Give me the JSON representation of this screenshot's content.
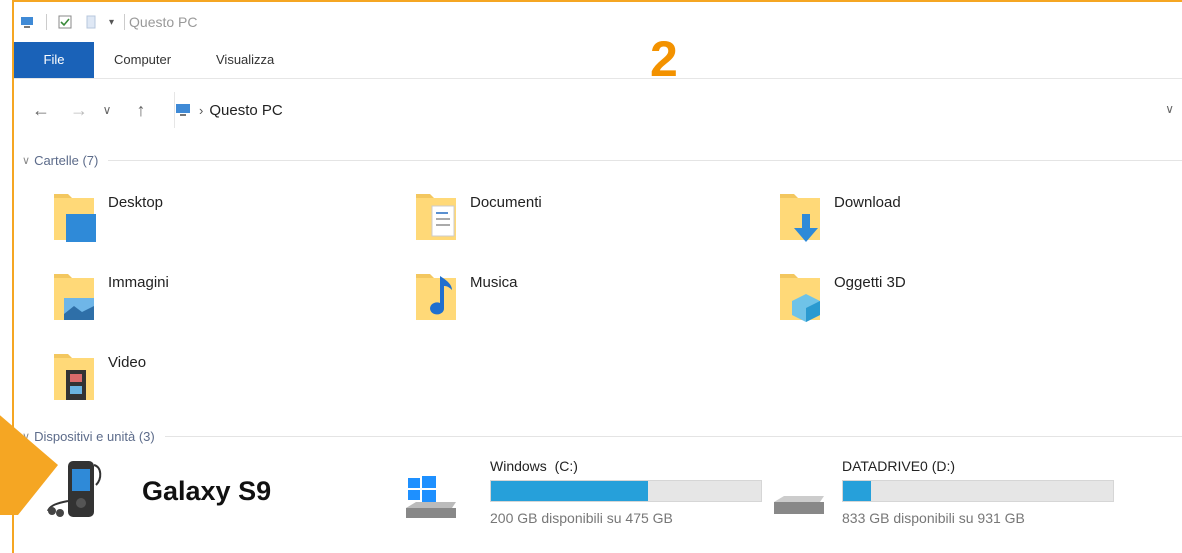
{
  "window": {
    "title": "Questo PC"
  },
  "ribbon": {
    "tabs": [
      {
        "label": "File"
      },
      {
        "label": "Computer"
      },
      {
        "label": "Visualizza"
      }
    ]
  },
  "step_number": "2",
  "address": {
    "path": "Questo PC"
  },
  "folders_group": {
    "label": "Cartelle (7)"
  },
  "folders": [
    {
      "label": "Desktop",
      "icon": "desktop-folder-icon"
    },
    {
      "label": "Documenti",
      "icon": "documents-folder-icon"
    },
    {
      "label": "Download",
      "icon": "download-folder-icon"
    },
    {
      "label": "Immagini",
      "icon": "pictures-folder-icon"
    },
    {
      "label": "Musica",
      "icon": "music-folder-icon"
    },
    {
      "label": "Oggetti 3D",
      "icon": "3d-objects-folder-icon"
    },
    {
      "label": "Video",
      "icon": "video-folder-icon"
    }
  ],
  "devices_group": {
    "label": "Dispositivi e unità (3)"
  },
  "devices": [
    {
      "label": "Galaxy S9",
      "icon": "phone-device-icon"
    },
    {
      "label": "Windows  (C:)",
      "free_text": "200 GB disponibili su 475 GB",
      "used_fraction": 0.58,
      "icon": "windows-drive-icon"
    },
    {
      "label": "DATADRIVE0 (D:)",
      "free_text": "833 GB disponibili su 931 GB",
      "used_fraction": 0.105,
      "icon": "hard-drive-icon"
    }
  ],
  "colors": {
    "accent_orange": "#f5a623",
    "file_tab_blue": "#1a62b8",
    "drive_bar_fill": "#26a0da"
  }
}
